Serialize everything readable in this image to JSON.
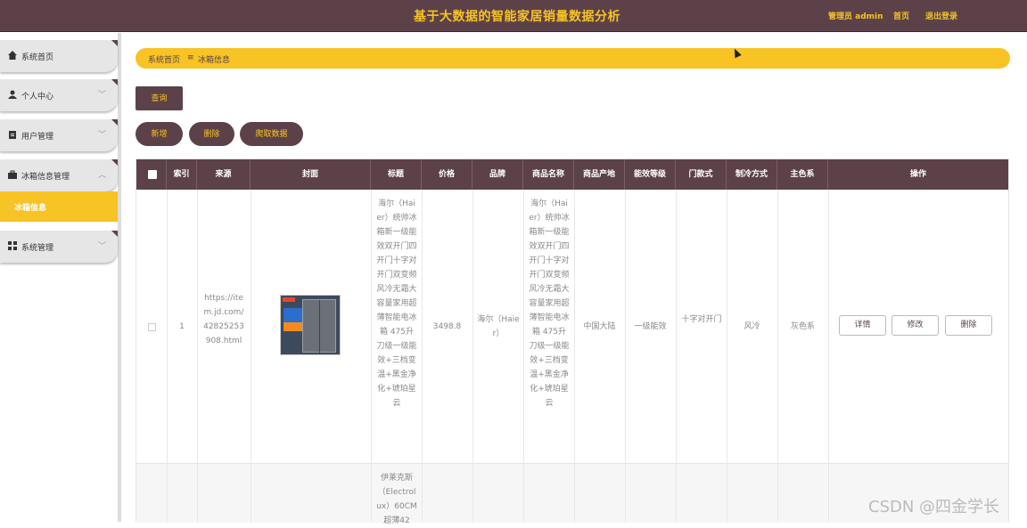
{
  "header": {
    "title": "基于大数据的智能家居销量数据分析",
    "admin_label": "管理员 admin",
    "back_label": "首页",
    "logout_label": "退出登录"
  },
  "sidebar": {
    "items": [
      {
        "label": "系统首页",
        "icon": "home-icon"
      },
      {
        "label": "个人中心",
        "icon": "user-icon"
      },
      {
        "label": "用户管理",
        "icon": "clipboard-icon"
      },
      {
        "label": "冰箱信息管理",
        "icon": "briefcase-icon"
      },
      {
        "label": "系统管理",
        "icon": "grid-icon"
      }
    ],
    "sub_item": "冰箱信息"
  },
  "breadcrumb": {
    "home": "系统首页",
    "separator": "≡",
    "current": "冰箱信息"
  },
  "toolbar": {
    "query_label": "查询",
    "add_label": "新增",
    "delete_label": "删除",
    "crawl_label": "爬取数据"
  },
  "table": {
    "headers": [
      "索引",
      "来源",
      "封面",
      "标题",
      "价格",
      "品牌",
      "商品名称",
      "商品产地",
      "能效等级",
      "门款式",
      "制冷方式",
      "主色系",
      "操作"
    ],
    "rows": [
      {
        "index": "1",
        "source": "https://item.jd.com/42825253908.html",
        "title": "海尔（Haier）统帅冰箱新一级能效双开门四开门十字对开门双变频风冷无霜大容量家用超薄智能电冰箱 475升刀级一级能效+三档变温+黑金净化+琥珀星云",
        "price": "3498.8",
        "brand": "海尔（Haier）",
        "name": "海尔（Haier）统帅冰箱新一级能效双开门四开门十字对开门双变频风冷无霜大容量家用超薄智能电冰箱 475升刀级一级能效+三档变温+黑金净化+琥珀星云",
        "origin": "中国大陆",
        "energy": "一级能效",
        "door": "十字对开门",
        "cooling": "风冷",
        "color": "灰色系"
      },
      {
        "title_partial": "伊莱克斯（Electrolux）60CM超薄42"
      }
    ],
    "ops": {
      "detail": "详情",
      "edit": "修改",
      "delete": "删除"
    }
  },
  "watermark": "CSDN @四金学长",
  "colors": {
    "brand_dark": "#5c4248",
    "accent": "#f7c325"
  }
}
